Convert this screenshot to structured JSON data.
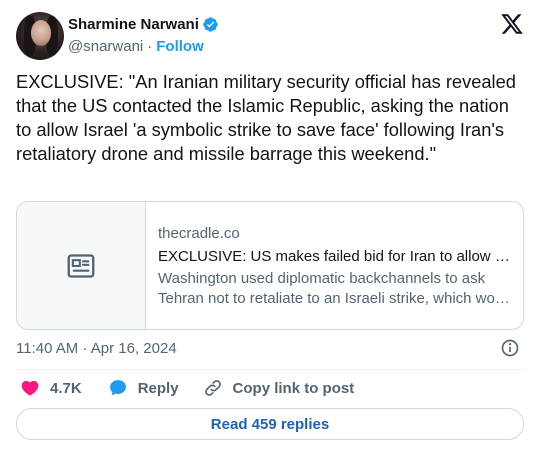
{
  "author": {
    "display_name": "Sharmine Narwani",
    "handle": "@snarwani",
    "separator": "·",
    "follow_label": "Follow",
    "verified": true
  },
  "tweet": {
    "text": "EXCLUSIVE: \"An Iranian military security official has revealed that the US contacted the Islamic Republic, asking the nation to allow Israel 'a symbolic strike to save face' following Iran's retaliatory drone and missile barrage this weekend.\""
  },
  "link_card": {
    "domain": "thecradle.co",
    "title": "EXCLUSIVE: US makes failed bid for Iran to allow '…",
    "description": "Washington used diplomatic backchannels to ask Tehran not to retaliate to an Israeli strike, which wo…",
    "thumbnail_icon": "news-article-icon"
  },
  "meta": {
    "timestamp": "11:40 AM · Apr 16, 2024"
  },
  "actions": {
    "like_count": "4.7K",
    "reply_label": "Reply",
    "copy_label": "Copy link to post"
  },
  "footer": {
    "read_replies_label": "Read 459 replies"
  },
  "colors": {
    "accent": "#1d9bf0",
    "like": "#f91880",
    "reply": "#1d9bf0",
    "text": "#0f1419",
    "muted": "#536471",
    "border": "#cfd9de"
  }
}
